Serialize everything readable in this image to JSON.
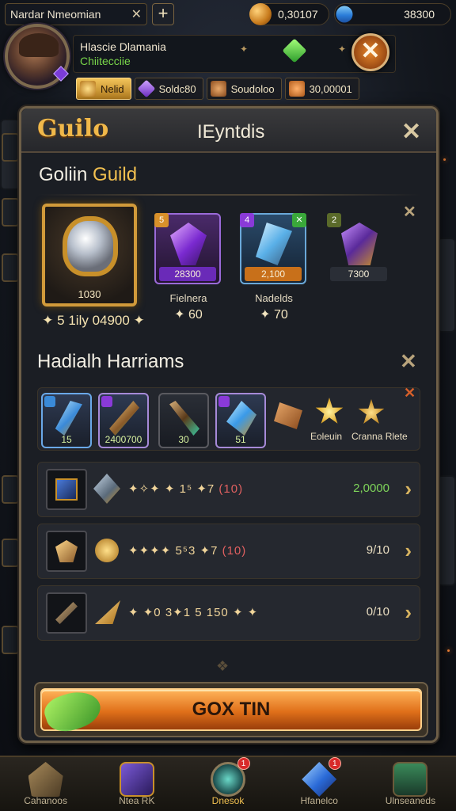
{
  "top": {
    "player_name": "Nardar Nmeomian",
    "close_glyph": "✕",
    "plus_glyph": "+",
    "gold": "0,30107",
    "gems": "38300"
  },
  "profile": {
    "title": "Hlascie Dlamania",
    "subtitle": "Chiitecciie",
    "close_glyph": "✕",
    "star_glyph": "✦"
  },
  "stats": [
    {
      "label": "Nelid",
      "icon": "gold-ingot-icon"
    },
    {
      "label": "Soldc80",
      "icon": "purple-crystal-icon"
    },
    {
      "label": "Soudoloo",
      "icon": "bronze-crystal-icon"
    },
    {
      "label": "30,00001",
      "icon": "orange-orb-icon"
    }
  ],
  "panel": {
    "tab_label": "Guilo",
    "title": "IEyntdis",
    "close_glyph": "✕"
  },
  "guild_section": {
    "title_white": "Goliin ",
    "title_gold": "Guild",
    "big_card": {
      "value": "1030",
      "caption": "✦ 5 1ily 04900 ✦"
    },
    "cards": [
      {
        "bar": "28300",
        "name": "Fielnera",
        "value": "✦ 60",
        "corner": "5"
      },
      {
        "bar": "2,100",
        "name": "Nadelds",
        "value": "✦ 70",
        "corner": "4"
      },
      {
        "bar": "7300",
        "name": "",
        "value": "",
        "corner": "2"
      }
    ],
    "x_glyph": "✕"
  },
  "items_section": {
    "title": "Hadialh Harriams",
    "x_glyph": "✕",
    "items": [
      {
        "value": "15"
      },
      {
        "value": "2400700"
      },
      {
        "value": "30"
      },
      {
        "value": "51"
      }
    ],
    "labels": [
      "Eoleuin",
      "Cranna Rlete"
    ]
  },
  "rows": [
    {
      "seq": "✦✧✦ ✦ 1⁵ ✦7",
      "paren": "(10)",
      "amount": "2,0000",
      "amount_color": "#7ed35a"
    },
    {
      "seq": "✦✦✦✦ 5⁵3 ✦7",
      "paren": "(10)",
      "amount": "9/10",
      "amount_color": "#e8dcc0"
    },
    {
      "seq": "✦ ✦0 3✦1 5 150 ✦ ✦",
      "paren": "",
      "amount": "0/10",
      "amount_color": "#e8dcc0"
    }
  ],
  "cta": {
    "label": "GOX TIN"
  },
  "nav": [
    {
      "label": "Cahanoos",
      "badge": "",
      "icon": "fort-icon"
    },
    {
      "label": "Ntea RK",
      "badge": "",
      "icon": "spellbook-icon"
    },
    {
      "label": "Dnesok",
      "badge": "1",
      "icon": "orb-icon"
    },
    {
      "label": "Hfanelco",
      "badge": "1",
      "icon": "crystal-icon"
    },
    {
      "label": "Ulnseaneds",
      "badge": "",
      "icon": "chest-icon"
    }
  ],
  "colors": {
    "gold_accent": "#f0b84a",
    "cta_orange": "#e0701a",
    "green_value": "#7ed35a",
    "panel_bg": "#1b1e24"
  }
}
